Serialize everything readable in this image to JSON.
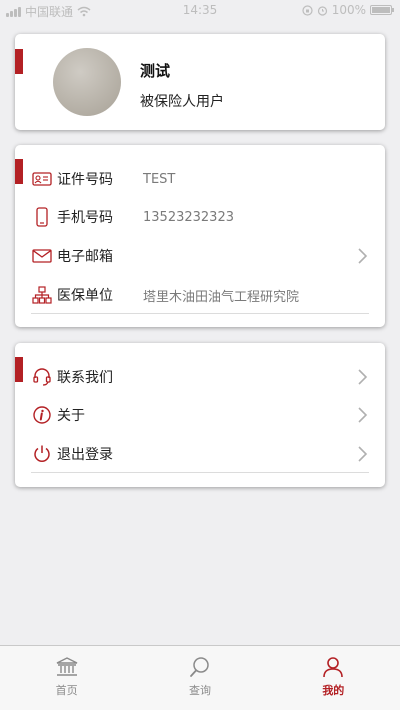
{
  "status_bar": {
    "carrier": "中国联通",
    "time": "14:35",
    "battery": "100%"
  },
  "profile": {
    "name": "测试",
    "role": "被保险人用户"
  },
  "info": {
    "rows": [
      {
        "label": "证件号码",
        "value": "TEST",
        "icon": "id-card-icon"
      },
      {
        "label": "手机号码",
        "value": "13523232323",
        "icon": "phone-icon"
      },
      {
        "label": "电子邮箱",
        "value": "",
        "icon": "mail-icon"
      },
      {
        "label": "医保单位",
        "value": "塔里木油田油气工程研究院",
        "icon": "org-chart-icon"
      }
    ]
  },
  "menu": {
    "items": [
      {
        "label": "联系我们",
        "icon": "headset-icon"
      },
      {
        "label": "关于",
        "icon": "info-icon"
      },
      {
        "label": "退出登录",
        "icon": "power-icon"
      }
    ]
  },
  "tabs": [
    {
      "label": "首页",
      "icon": "bank-icon"
    },
    {
      "label": "查询",
      "icon": "search-icon"
    },
    {
      "label": "我的",
      "icon": "user-icon",
      "active": true
    }
  ],
  "colors": {
    "accent": "#b32024",
    "background": "#efeff1"
  }
}
